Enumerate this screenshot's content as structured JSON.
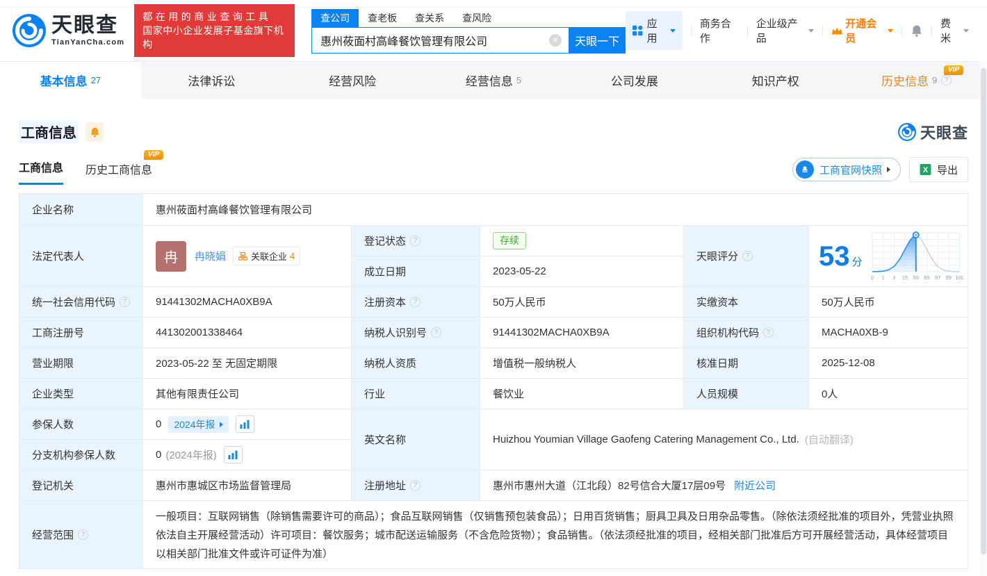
{
  "header": {
    "brand": {
      "name": "天眼查",
      "domain": "TianYanCha.com"
    },
    "banner": {
      "line1": "都在用的商业查询工具",
      "line2": "国家中小企业发展子基金旗下机构"
    },
    "search": {
      "tabs": [
        {
          "label": "查公司"
        },
        {
          "label": "查老板"
        },
        {
          "label": "查关系"
        },
        {
          "label": "查风险"
        }
      ],
      "input_value": "惠州莜面村高峰餐饮管理有限公司",
      "submit_label": "天眼一下"
    },
    "menu": {
      "apps": "应用",
      "business_coop": "商务合作",
      "enterprise_products": "企业级产品",
      "vip": "开通会员",
      "username": "费米"
    }
  },
  "nav_tabs": [
    {
      "label": "基本信息",
      "count": "27"
    },
    {
      "label": "法律诉讼",
      "count": ""
    },
    {
      "label": "经营风险",
      "count": ""
    },
    {
      "label": "经营信息",
      "count": "5"
    },
    {
      "label": "公司发展",
      "count": ""
    },
    {
      "label": "知识产权",
      "count": ""
    },
    {
      "label": "历史信息",
      "count": "9"
    }
  ],
  "section": {
    "title": "工商信息",
    "watermark_brand": "天眼查",
    "tabs": [
      {
        "label": "工商信息"
      },
      {
        "label": "历史工商信息"
      }
    ],
    "vip_badge": "VIP",
    "snapshot_button": "工商官网快照",
    "export_button": "导出"
  },
  "table": {
    "company_name": {
      "label": "企业名称",
      "value": "惠州莜面村高峰餐饮管理有限公司"
    },
    "legal_rep": {
      "label": "法定代表人",
      "avatar_char": "冉",
      "name": "冉晓娟",
      "related_label": "关联企业",
      "related_count": "4"
    },
    "reg_status": {
      "label": "登记状态",
      "value": "存续"
    },
    "est_date": {
      "label": "成立日期",
      "value": "2023-05-22"
    },
    "score": {
      "label": "天眼评分",
      "value": "53",
      "unit": "分"
    },
    "credit_code": {
      "label": "统一社会信用代码",
      "value": "91441302MACHA0XB9A"
    },
    "reg_capital": {
      "label": "注册资本",
      "value": "50万人民币"
    },
    "paid_capital": {
      "label": "实缴资本",
      "value": "50万人民币"
    },
    "reg_number": {
      "label": "工商注册号",
      "value": "441302001338464"
    },
    "taxpayer_id": {
      "label": "纳税人识别号",
      "value": "91441302MACHA0XB9A"
    },
    "org_code": {
      "label": "组织机构代码",
      "value": "MACHA0XB-9"
    },
    "business_term": {
      "label": "营业期限",
      "value": "2023-05-22 至 无固定期限"
    },
    "taxpayer_quality": {
      "label": "纳税人资质",
      "value": "增值税一般纳税人"
    },
    "approval_date": {
      "label": "核准日期",
      "value": "2025-12-08"
    },
    "company_type": {
      "label": "企业类型",
      "value": "其他有限责任公司"
    },
    "industry": {
      "label": "行业",
      "value": "餐饮业"
    },
    "staff_size": {
      "label": "人员规模",
      "value": "0人"
    },
    "insured_count": {
      "label": "参保人数",
      "value": "0",
      "report_tag": "2024年报"
    },
    "branch_insured": {
      "label": "分支机构参保人数",
      "value": "0",
      "note": "(2024年报)"
    },
    "english_name": {
      "label": "英文名称",
      "value": "Huizhou Youmian Village Gaofeng Catering Management Co., Ltd.",
      "note": "(自动翻译)"
    },
    "reg_authority": {
      "label": "登记机关",
      "value": "惠州市惠城区市场监督管理局"
    },
    "reg_address": {
      "label": "注册地址",
      "value": "惠州市惠州大道（江北段）82号信合大厦17层09号",
      "nearby_link": "附近公司"
    },
    "business_scope": {
      "label": "经营范围",
      "value": "一般项目：互联网销售（除销售需要许可的商品）；食品互联网销售（仅销售预包装食品）；日用百货销售；厨具卫具及日用杂品零售。（除依法须经批准的项目外，凭营业执照依法自主开展经营活动）许可项目：餐饮服务；城市配送运输服务（不含危险货物）；食品销售。（依法须经批准的项目，经相关部门批准后方可开展经营活动，具体经营项目以相关部门批准文件或许可证件为准）"
    }
  },
  "chart_data": {
    "type": "area",
    "title": "天眼评分分布曲线",
    "x_ticks": [
      "0",
      "1",
      "3",
      "15",
      "50",
      "85",
      "97",
      "99",
      "100"
    ],
    "marker_tick": "50",
    "score": 53
  },
  "colors": {
    "accent_blue": "#0b82f0",
    "link_blue": "#1888e8",
    "banner_red": "#e23a38",
    "vip_orange": "#ff7e00",
    "status_green": "#48ab37",
    "label_bg": "#eaf4fd"
  }
}
